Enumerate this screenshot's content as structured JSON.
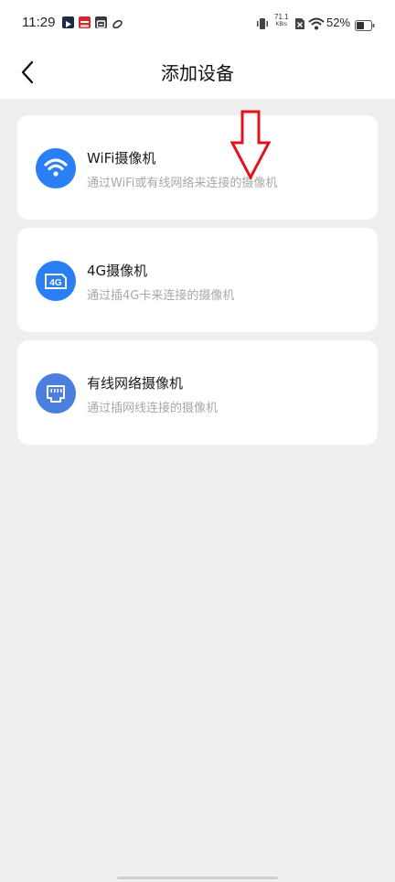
{
  "status_bar": {
    "time": "11:29",
    "net_speed_value": "71.1",
    "net_speed_unit": "KB/s",
    "battery": "52%"
  },
  "header": {
    "title": "添加设备",
    "back_icon": "chevron-left-icon"
  },
  "devices": [
    {
      "name": "WiFi摄像机",
      "desc": "通过WiFi或有线网络来连接的摄像机",
      "icon": "wifi-icon",
      "color": "#2b7ff5"
    },
    {
      "name": "4G摄像机",
      "desc": "通过插4G卡来连接的摄像机",
      "icon": "4g-icon",
      "icon_text": "4G",
      "color": "#2b7ff5"
    },
    {
      "name": "有线网络摄像机",
      "desc": "通过插网线连接的摄像机",
      "icon": "ethernet-port-icon",
      "color": "#4a7fe0"
    }
  ],
  "annotation": {
    "icon": "red-down-arrow-icon",
    "color": "#e0141c"
  }
}
